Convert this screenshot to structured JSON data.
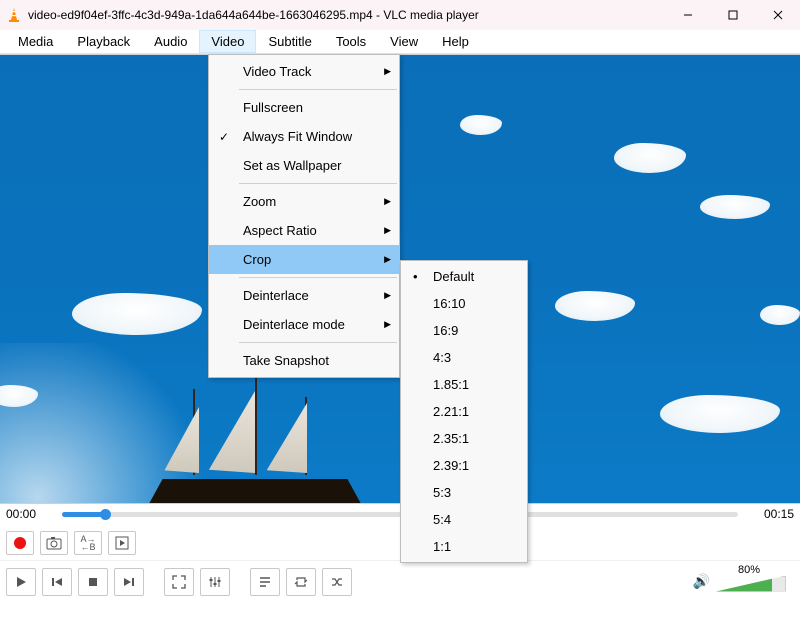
{
  "titlebar": {
    "title": "video-ed9f04ef-3ffc-4c3d-949a-1da644a644be-1663046295.mp4 - VLC media player"
  },
  "menubar": {
    "items": [
      "Media",
      "Playback",
      "Audio",
      "Video",
      "Subtitle",
      "Tools",
      "View",
      "Help"
    ],
    "open_index": 3
  },
  "video_menu": [
    {
      "label": "Video Track",
      "arrow": true
    },
    {
      "sep": true
    },
    {
      "label": "Fullscreen"
    },
    {
      "label": "Always Fit Window",
      "check": true
    },
    {
      "label": "Set as Wallpaper"
    },
    {
      "sep": true
    },
    {
      "label": "Zoom",
      "arrow": true
    },
    {
      "label": "Aspect Ratio",
      "arrow": true
    },
    {
      "label": "Crop",
      "arrow": true,
      "hl": true
    },
    {
      "sep": true
    },
    {
      "label": "Deinterlace",
      "arrow": true
    },
    {
      "label": "Deinterlace mode",
      "arrow": true
    },
    {
      "sep": true
    },
    {
      "label": "Take Snapshot"
    }
  ],
  "crop_menu": [
    {
      "label": "Default",
      "dot": true
    },
    {
      "label": "16:10"
    },
    {
      "label": "16:9"
    },
    {
      "label": "4:3"
    },
    {
      "label": "1.85:1"
    },
    {
      "label": "2.21:1"
    },
    {
      "label": "2.35:1"
    },
    {
      "label": "2.39:1"
    },
    {
      "label": "5:3"
    },
    {
      "label": "5:4"
    },
    {
      "label": "1:1"
    }
  ],
  "seek": {
    "current": "00:00",
    "total": "00:15"
  },
  "volume": {
    "percent_label": "80%"
  }
}
